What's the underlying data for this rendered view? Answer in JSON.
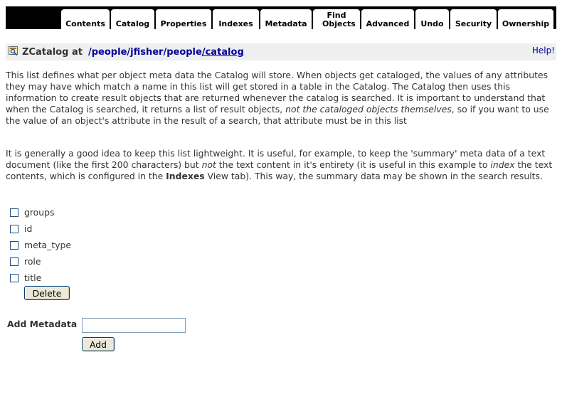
{
  "tabs": [
    {
      "label": "Contents"
    },
    {
      "label": "Catalog"
    },
    {
      "label": "Properties"
    },
    {
      "label": "Indexes"
    },
    {
      "label": "Metadata",
      "active": true
    },
    {
      "label": "Find Objects"
    },
    {
      "label": "Advanced"
    },
    {
      "label": "Undo"
    },
    {
      "label": "Security"
    },
    {
      "label": "Ownership"
    }
  ],
  "header": {
    "title": "ZCatalog at",
    "path": [
      {
        "label": "/people"
      },
      {
        "label": "/jfisher"
      },
      {
        "label": "/people"
      },
      {
        "label": "/catalog"
      }
    ],
    "help": "Help!"
  },
  "description": {
    "p1_a": "This list defines what per object meta data the Catalog will store. When objects get cataloged, the values of any attributes they may have which match a name in this list will get stored in a table in the Catalog. The Catalog then uses this information to create result objects that are returned whenever the catalog is searched. It is important to understand that when the Catalog is searched, it returns a list of result objects, ",
    "p1_em": "not the cataloged objects themselves",
    "p1_b": ", so if you want to use the value of an object's attribute in the result of a search, that attribute must be in this list",
    "p2_a": "It is generally a good idea to keep this list lightweight. It is useful, for example, to keep the 'summary' meta data of a text document (like the first 200 characters) but ",
    "p2_em1": "not",
    "p2_b": " the text content in it's entirety (it is useful in this example to ",
    "p2_em2": "index",
    "p2_c": " the text contents, which is configured in the ",
    "p2_strong": "Indexes",
    "p2_d": " View tab). This way, the summary data may be shown in the search results."
  },
  "metadata": {
    "items": [
      {
        "label": "groups",
        "checked": false
      },
      {
        "label": "id",
        "checked": false
      },
      {
        "label": "meta_type",
        "checked": false
      },
      {
        "label": "role",
        "checked": false
      },
      {
        "label": "title",
        "checked": false
      }
    ],
    "delete_label": "Delete"
  },
  "add_form": {
    "label": "Add Metadata",
    "value": "",
    "button_label": "Add"
  },
  "colors": {
    "tab_strip": "#000000",
    "title_bar": "#efefef",
    "link": "#000099",
    "text": "#333333"
  },
  "icons": {
    "catalog": "zcatalog-icon"
  }
}
